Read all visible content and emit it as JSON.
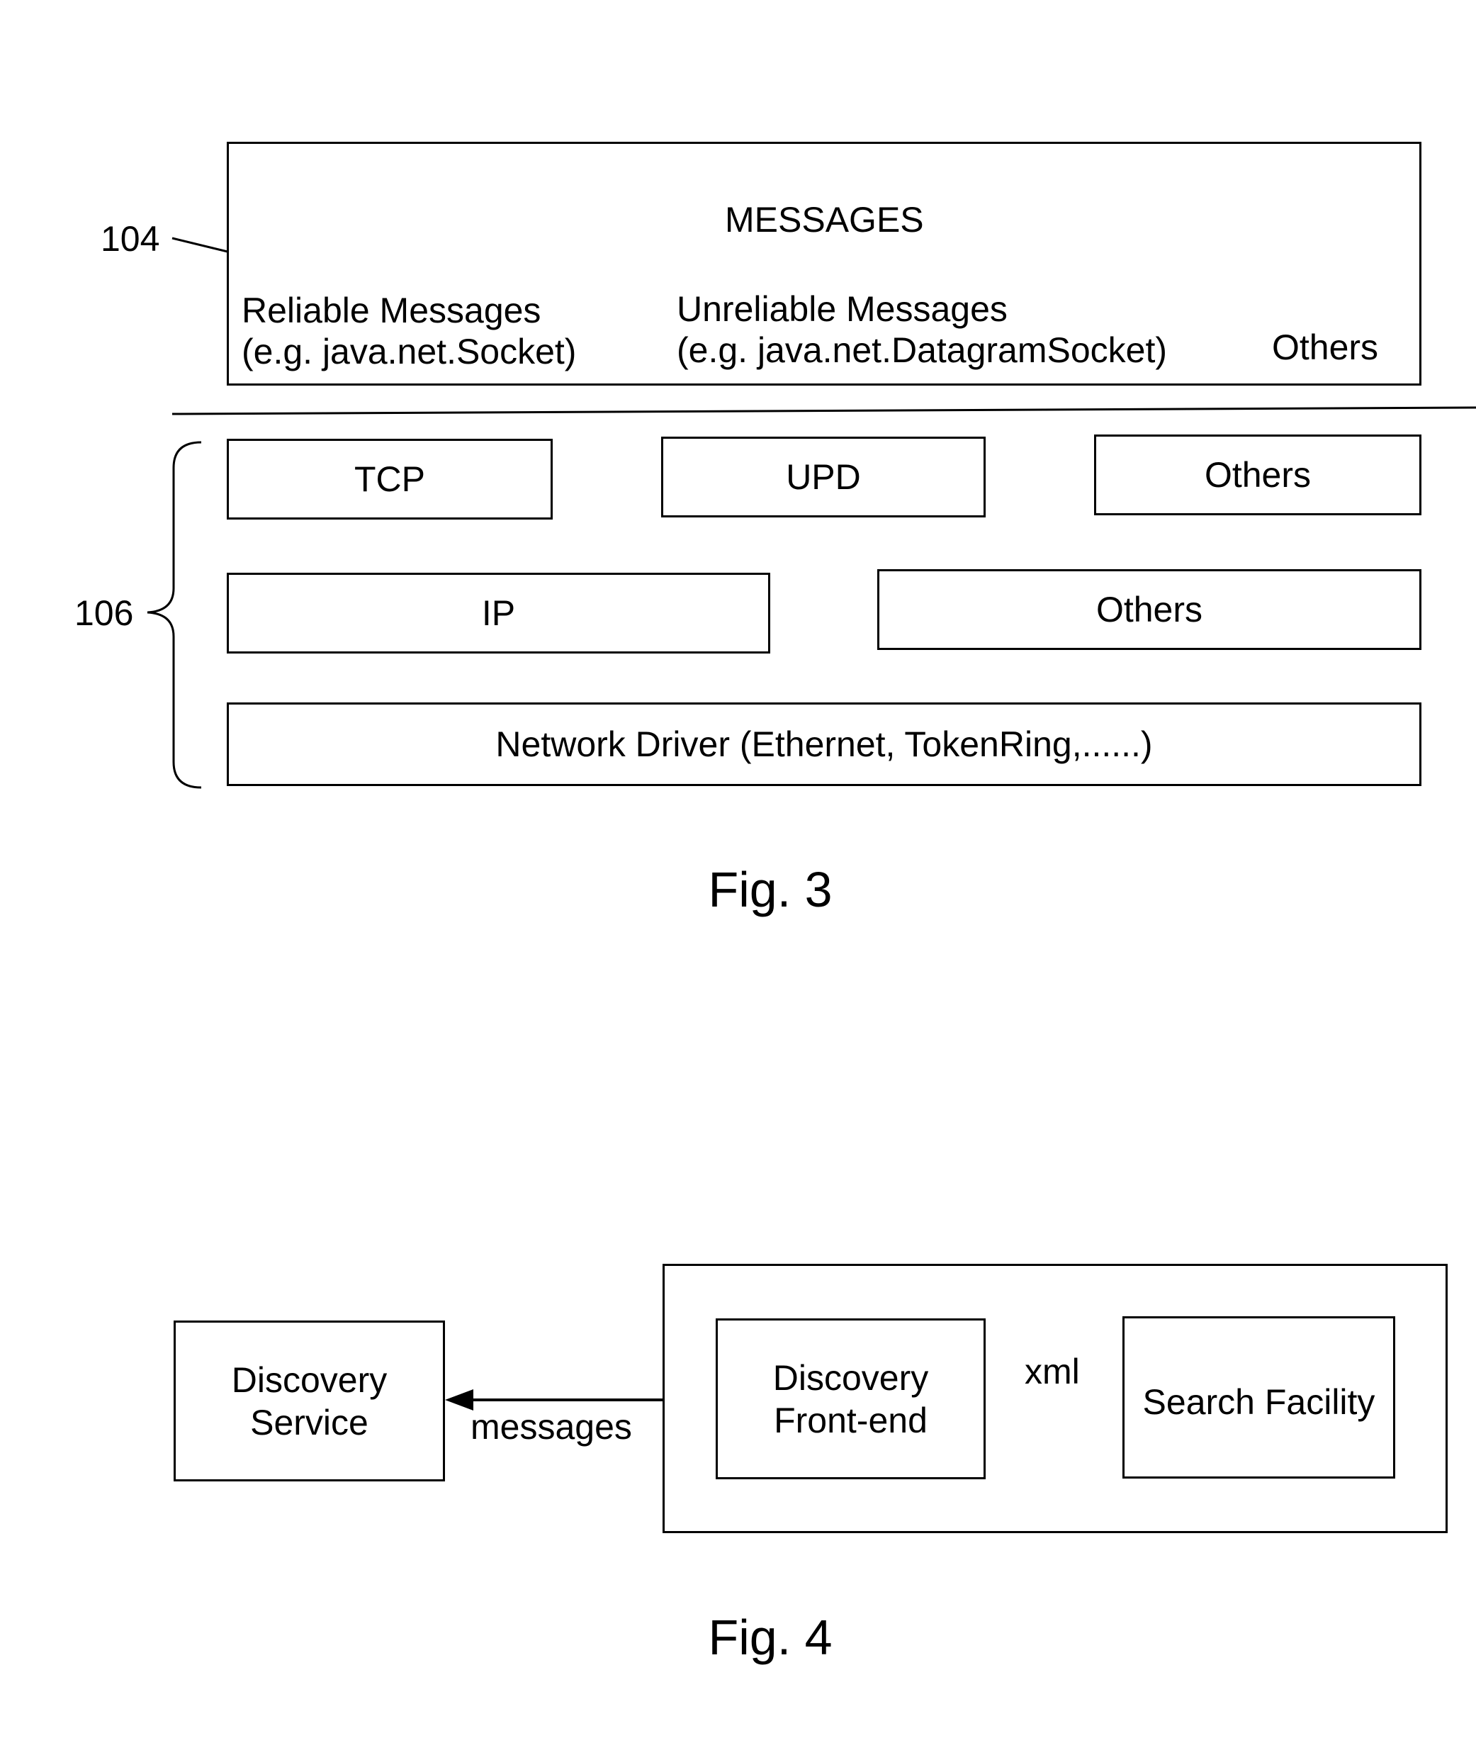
{
  "fig3": {
    "caption": "Fig. 3",
    "messages_layer": {
      "ref": "104",
      "title": "MESSAGES",
      "reliable": {
        "line1": "Reliable Messages",
        "line2": "(e.g. java.net.Socket)"
      },
      "unreliable": {
        "line1": "Unreliable Messages",
        "line2": "(e.g. java.net.DatagramSocket)"
      },
      "others": "Others"
    },
    "network_stack": {
      "ref": "106",
      "transport": [
        "TCP",
        "UPD",
        "Others"
      ],
      "network": [
        "IP",
        "Others"
      ],
      "driver": "Network Driver (Ethernet, TokenRing,......)"
    }
  },
  "fig4": {
    "caption": "Fig. 4",
    "discovery_service": {
      "line1": "Discovery",
      "line2": "Service"
    },
    "discovery_frontend": {
      "line1": "Discovery",
      "line2": "Front-end"
    },
    "search_facility": "Search Facility",
    "messages_label": "messages",
    "xml_label": "xml"
  }
}
